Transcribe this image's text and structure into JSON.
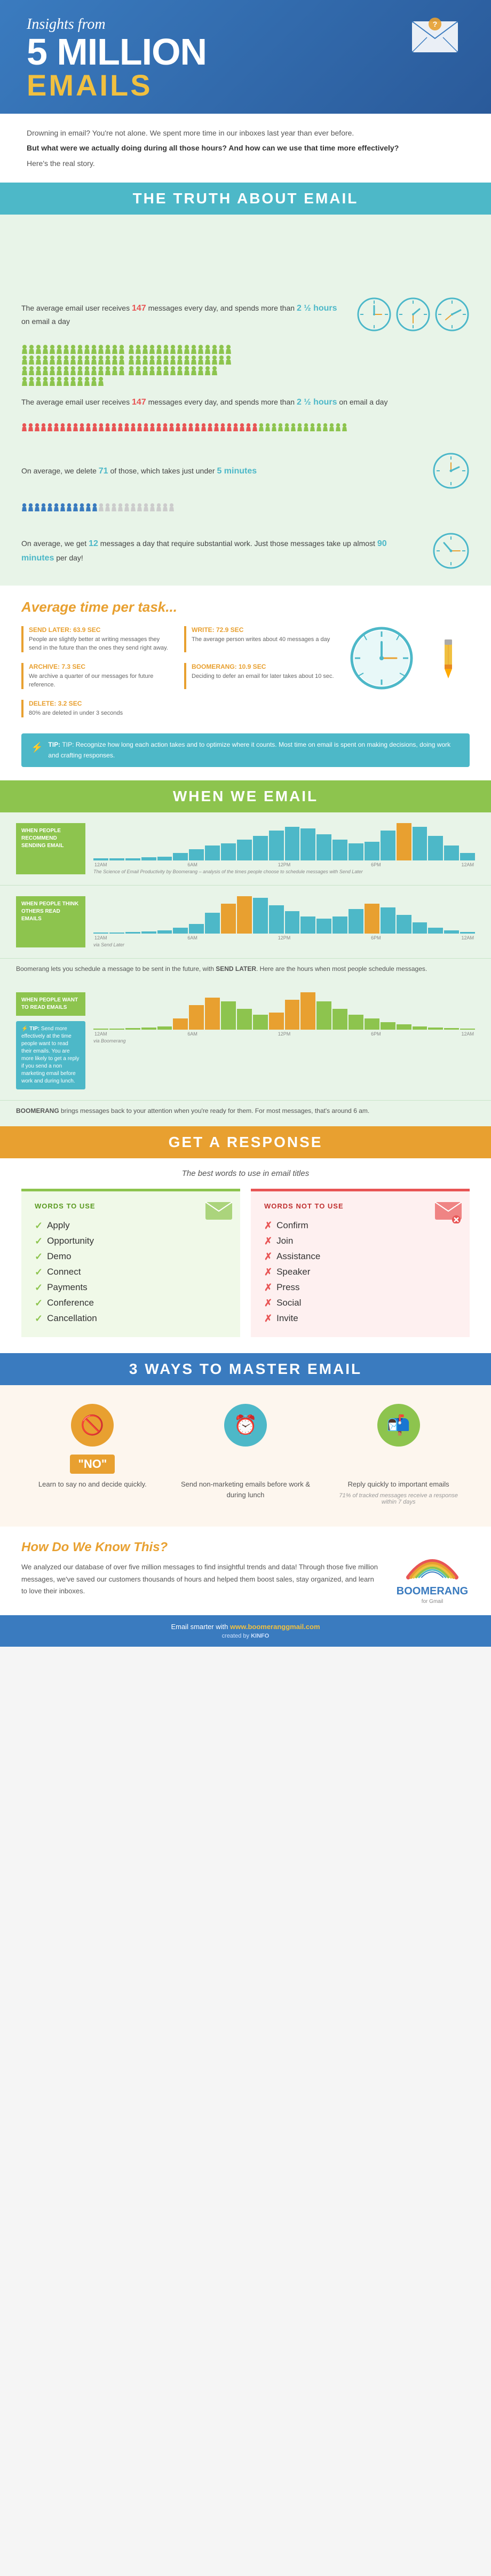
{
  "header": {
    "line1": "Insights from",
    "line2": "5 MILLION",
    "line3": "EMAILS"
  },
  "intro": {
    "p1": "Drowning in email? You're not alone. We spent more time in our inboxes last year than ever before.",
    "p2": "But what were we actually doing during all those hours? And how can we use that time more effectively?",
    "p3": "Here's the real story."
  },
  "truth_header": "THE TRUTH ABOUT EMAIL",
  "truth": {
    "stat1_prefix": "The average email user receives ",
    "stat1_num": "147",
    "stat1_suffix": " messages every day, and spends more than ",
    "stat1_hours": "2 ½ hours",
    "stat1_end": " on email a day",
    "stat2_prefix": "On average, we delete ",
    "stat2_num": "71",
    "stat2_suffix": " of those, which takes just under ",
    "stat2_time": "5 minutes",
    "stat3_prefix": "On average, we get ",
    "stat3_num": "12",
    "stat3_suffix": " messages a day that require substantial work. Just those messages take up almost ",
    "stat3_time": "90 minutes",
    "stat3_end": " per day!"
  },
  "avg_time": {
    "title": "Average time per task...",
    "stats": [
      {
        "label": "SEND LATER: 63.9 SEC",
        "value": "63.9 SEC",
        "key": "send_later",
        "desc": "People are slightly better at writing messages they send in the future than the ones they send right away."
      },
      {
        "label": "ARCHIVE: 7.3 SEC",
        "value": "7.3 SEC",
        "key": "archive",
        "desc": "We archive a quarter of our messages for future reference."
      },
      {
        "label": "DELETE: 3.2 SEC",
        "value": "3.2 SEC",
        "key": "delete",
        "desc": "80% are deleted in under 3 seconds"
      },
      {
        "label": "BOOMERANG: 10.9 SEC",
        "value": "10.9 SEC",
        "key": "boomerang",
        "desc": "Deciding to defer an email for later takes about 10 sec."
      },
      {
        "label": "WRITE: 72.9 SEC",
        "value": "72.9 SEC",
        "key": "write",
        "desc": "The average person writes about 40 messages a day"
      }
    ],
    "tip": "TIP: Recognize how long each action takes and to optimize where it counts. Most time on email is spent on making decisions, doing work and crafting responses."
  },
  "when_email_header": "WHEN WE EMAIL",
  "when": {
    "recommend_label": "WHEN PEOPLE RECOMMEND SENDING EMAIL",
    "recommend_source": "The Science of Email Productivity by Boomerang – analysis of the times people choose to schedule messages with Send Later",
    "recommend_bars": [
      2,
      3,
      4,
      5,
      6,
      10,
      15,
      20,
      18,
      25,
      35,
      50,
      45,
      30,
      20,
      15,
      10,
      12,
      30,
      55,
      70,
      45,
      25,
      15
    ],
    "recommend_labels": [
      "12AM",
      "6AM",
      "12PM",
      "6PM",
      "12AM"
    ],
    "read_label": "WHEN PEOPLE THINK OTHERS READ EMAILS",
    "read_source": "via Send Later",
    "read_bars": [
      2,
      2,
      3,
      3,
      5,
      8,
      15,
      35,
      55,
      70,
      60,
      45,
      30,
      20,
      15,
      20,
      35,
      55,
      40,
      25,
      15,
      8,
      5,
      3
    ],
    "read_labels": [
      "12AM",
      "6AM",
      "12PM",
      "6PM",
      "12AM"
    ],
    "boomerang_note": "Boomerang lets you schedule a message to be sent in the future, with SEND LATER. Here are the hours when most people schedule messages.",
    "want_label": "WHEN PEOPLE WANT TO READ EMAILS",
    "want_source": "via Boomerang",
    "want_bars": [
      2,
      2,
      3,
      4,
      6,
      20,
      45,
      60,
      50,
      35,
      25,
      30,
      45,
      55,
      40,
      30,
      20,
      15,
      10,
      8,
      5,
      4,
      3,
      2
    ],
    "want_labels": [
      "12AM",
      "6AM",
      "12PM",
      "6PM",
      "12AM"
    ],
    "want_tip": "TIP: Send more effectively at the time people want to read their emails. You are more likely to get a reply if you send a non marketing email before work and during lunch.",
    "boomerang_note2": "BOOMERANG brings messages back to your attention when you're ready for them. For most messages, that's around 6 am."
  },
  "response_header": "GET A RESPONSE",
  "response": {
    "subtitle": "The best words to use in email titles",
    "words_use_header": "WORDS TO USE",
    "words_not_use_header": "WORDS NOT TO USE",
    "words_use": [
      "Apply",
      "Opportunity",
      "Demo",
      "Connect",
      "Payments",
      "Conference",
      "Cancellation"
    ],
    "words_not_use": [
      "Confirm",
      "Join",
      "Assistance",
      "Speaker",
      "Press",
      "Social",
      "Invite"
    ]
  },
  "master_header": "3 WAYS TO MASTER EMAIL",
  "master": {
    "ways": [
      {
        "icon": "🚫",
        "text": "Learn to say no and decide quickly.",
        "stat": ""
      },
      {
        "icon": "📧",
        "text": "Send non-marketing emails before work & during lunch",
        "stat": ""
      },
      {
        "icon": "📬",
        "text": "Reply quickly to important emails",
        "stat": "71% of tracked messages receive a response within 7 days"
      }
    ]
  },
  "how_header": "How Do We Know This?",
  "how": {
    "body": "We analyzed our database of over five million messages to find insightful trends and data! Through those five million messages, we've saved our customers thousands of hours and helped them boost sales, stay organized, and learn to love their inboxes."
  },
  "footer": {
    "text": "Email smarter with ",
    "url": "www.boomeranggmail.com",
    "created": "created by"
  }
}
